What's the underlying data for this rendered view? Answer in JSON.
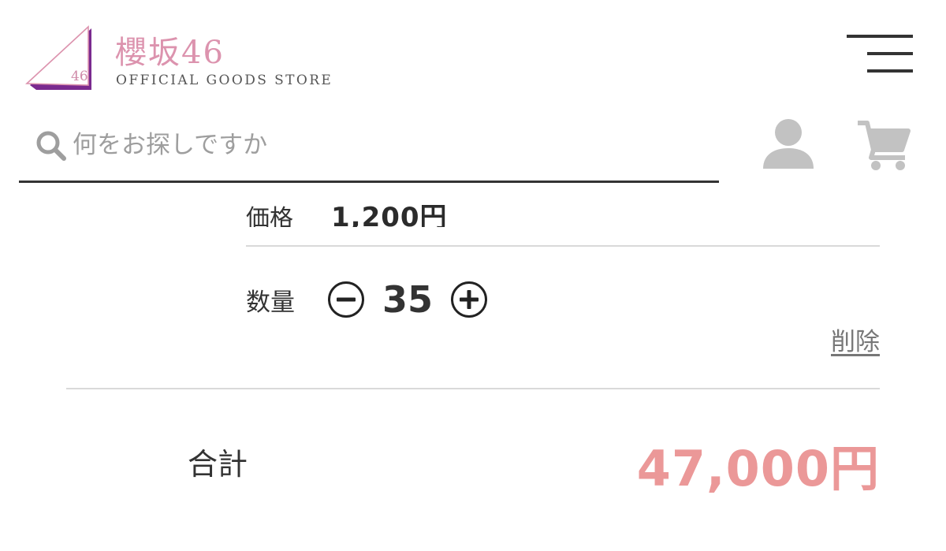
{
  "header": {
    "logo_number": "46",
    "brand_name": "櫻坂46",
    "brand_subtitle": "OFFICIAL GOODS STORE"
  },
  "search": {
    "placeholder": "何をお探しですか",
    "value": ""
  },
  "cart_item": {
    "price_label": "価格",
    "price_value": "1,200円",
    "quantity_label": "数量",
    "quantity": "35",
    "delete_label": "削除"
  },
  "summary": {
    "total_label": "合計",
    "total_value": "47,000円"
  },
  "colors": {
    "brand_pink": "#dc93ae",
    "brand_purple": "#7a2a8f",
    "total_pink": "#eb9898",
    "icon_gray": "#c2c2c2"
  },
  "icons": [
    "logo-icon",
    "menu-icon",
    "search-icon",
    "account-icon",
    "cart-icon",
    "minus-icon",
    "plus-icon"
  ]
}
